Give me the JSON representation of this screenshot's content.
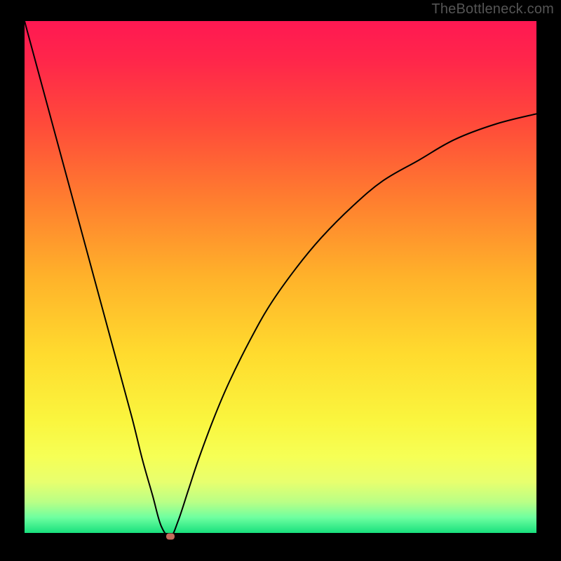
{
  "watermark": "TheBottleneck.com",
  "colors": {
    "frame": "#000000",
    "watermark": "#555555",
    "curve": "#000000",
    "marker": "#c46a5b",
    "gradient_stops": [
      {
        "offset": 0.0,
        "color": "#ff1852"
      },
      {
        "offset": 0.08,
        "color": "#ff274a"
      },
      {
        "offset": 0.2,
        "color": "#ff4a3a"
      },
      {
        "offset": 0.35,
        "color": "#ff7e2f"
      },
      {
        "offset": 0.5,
        "color": "#ffb22a"
      },
      {
        "offset": 0.65,
        "color": "#ffdb2e"
      },
      {
        "offset": 0.78,
        "color": "#faf53e"
      },
      {
        "offset": 0.85,
        "color": "#f6ff55"
      },
      {
        "offset": 0.9,
        "color": "#e8ff6e"
      },
      {
        "offset": 0.94,
        "color": "#b9ff86"
      },
      {
        "offset": 0.97,
        "color": "#6effa0"
      },
      {
        "offset": 1.0,
        "color": "#18e07d"
      }
    ]
  },
  "chart_data": {
    "type": "line",
    "title": "",
    "xlabel": "",
    "ylabel": "",
    "xlim": [
      0,
      100
    ],
    "ylim": [
      0,
      100
    ],
    "grid": false,
    "series": [
      {
        "name": "bottleneck-curve",
        "x": [
          0,
          3,
          6,
          9,
          12,
          15,
          18,
          21,
          23,
          25,
          26.7,
          28.5,
          30,
          32,
          34,
          37,
          40,
          44,
          48,
          53,
          58,
          64,
          70,
          77,
          84,
          92,
          100
        ],
        "y": [
          100,
          89,
          78,
          67,
          56,
          45,
          34,
          23,
          15,
          8,
          2,
          0,
          3,
          9,
          15,
          23,
          30,
          38,
          45,
          52,
          58,
          64,
          69,
          73,
          77,
          80,
          82
        ]
      }
    ],
    "annotations": [
      {
        "name": "minimum-marker",
        "x": 28.5,
        "y": 0
      }
    ]
  }
}
